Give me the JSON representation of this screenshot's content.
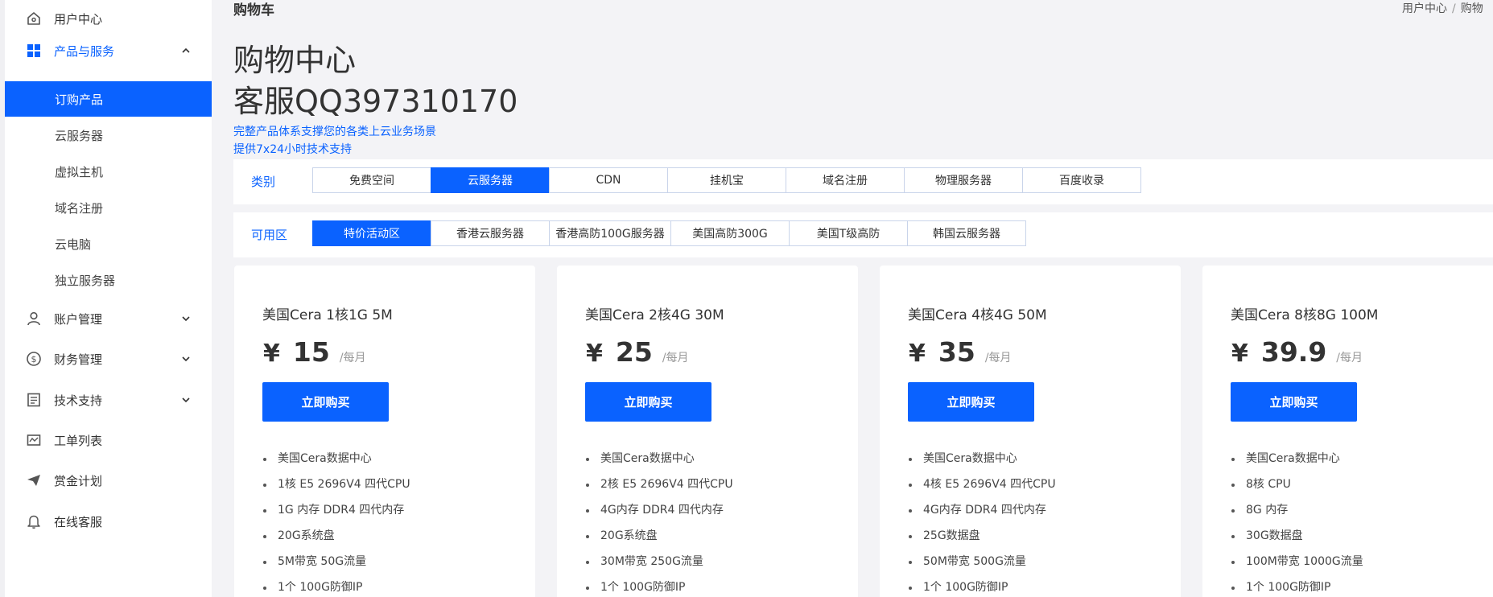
{
  "sidebar": {
    "top_items": [
      {
        "label": "用户中心",
        "icon": "home-icon"
      }
    ],
    "products": {
      "label": "产品与服务",
      "icon": "grid-icon"
    },
    "sub_items": [
      {
        "label": "订购产品"
      },
      {
        "label": "云服务器"
      },
      {
        "label": "虚拟主机"
      },
      {
        "label": "域名注册"
      },
      {
        "label": "云电脑"
      },
      {
        "label": "独立服务器"
      }
    ],
    "bottom_items": [
      {
        "label": "账户管理",
        "icon": "user-icon"
      },
      {
        "label": "财务管理",
        "icon": "dollar-circle-icon"
      },
      {
        "label": "技术支持",
        "icon": "document-icon"
      },
      {
        "label": "工单列表",
        "icon": "ticket-icon"
      },
      {
        "label": "赏金计划",
        "icon": "paper-plane-icon"
      },
      {
        "label": "在线客服",
        "icon": "bell-icon"
      }
    ]
  },
  "header": {
    "page_title": "购物车",
    "breadcrumb": [
      "用户中心",
      "购物"
    ],
    "big_title_1": "购物中心",
    "big_title_2": "客服QQ397310170",
    "sub_line_1": "完整产品体系支撑您的各类上云业务场景",
    "sub_line_2": "提供7x24小时技术支持"
  },
  "category": {
    "label": "类别",
    "options": [
      "免费空间",
      "云服务器",
      "CDN",
      "挂机宝",
      "域名注册",
      "物理服务器",
      "百度收录"
    ],
    "selected": "云服务器"
  },
  "zone": {
    "label": "可用区",
    "options": [
      "特价活动区",
      "香港云服务器",
      "香港高防100G服务器",
      "美国高防300G",
      "美国T级高防",
      "韩国云服务器"
    ],
    "selected": "特价活动区"
  },
  "products": [
    {
      "name": "美国Cera 1核1G 5M",
      "currency": "¥",
      "price": "15",
      "period": "/每月",
      "buy": "立即购买",
      "features": [
        "美国Cera数据中心",
        "1核 E5 2696V4 四代CPU",
        "1G 内存 DDR4 四代内存",
        "20G系统盘",
        "5M带宽 50G流量",
        "1个 100G防御IP"
      ]
    },
    {
      "name": "美国Cera 2核4G 30M",
      "currency": "¥",
      "price": "25",
      "period": "/每月",
      "buy": "立即购买",
      "features": [
        "美国Cera数据中心",
        "2核 E5 2696V4 四代CPU",
        "4G内存 DDR4 四代内存",
        "20G系统盘",
        "30M带宽 250G流量",
        "1个 100G防御IP"
      ]
    },
    {
      "name": "美国Cera 4核4G 50M",
      "currency": "¥",
      "price": "35",
      "period": "/每月",
      "buy": "立即购买",
      "features": [
        "美国Cera数据中心",
        "4核 E5 2696V4 四代CPU",
        "4G内存 DDR4 四代内存",
        "25G数据盘",
        "50M带宽 500G流量",
        "1个 100G防御IP"
      ]
    },
    {
      "name": "美国Cera 8核8G 100M",
      "currency": "¥",
      "price": "39.9",
      "period": "/每月",
      "buy": "立即购买",
      "features": [
        "美国Cera数据中心",
        "8核 CPU",
        "8G 内存",
        "30G数据盘",
        "100M带宽 1000G流量",
        "1个 100G防御IP"
      ]
    }
  ],
  "colors": {
    "accent": "#0a62ff",
    "background": "#f3f3f6"
  }
}
